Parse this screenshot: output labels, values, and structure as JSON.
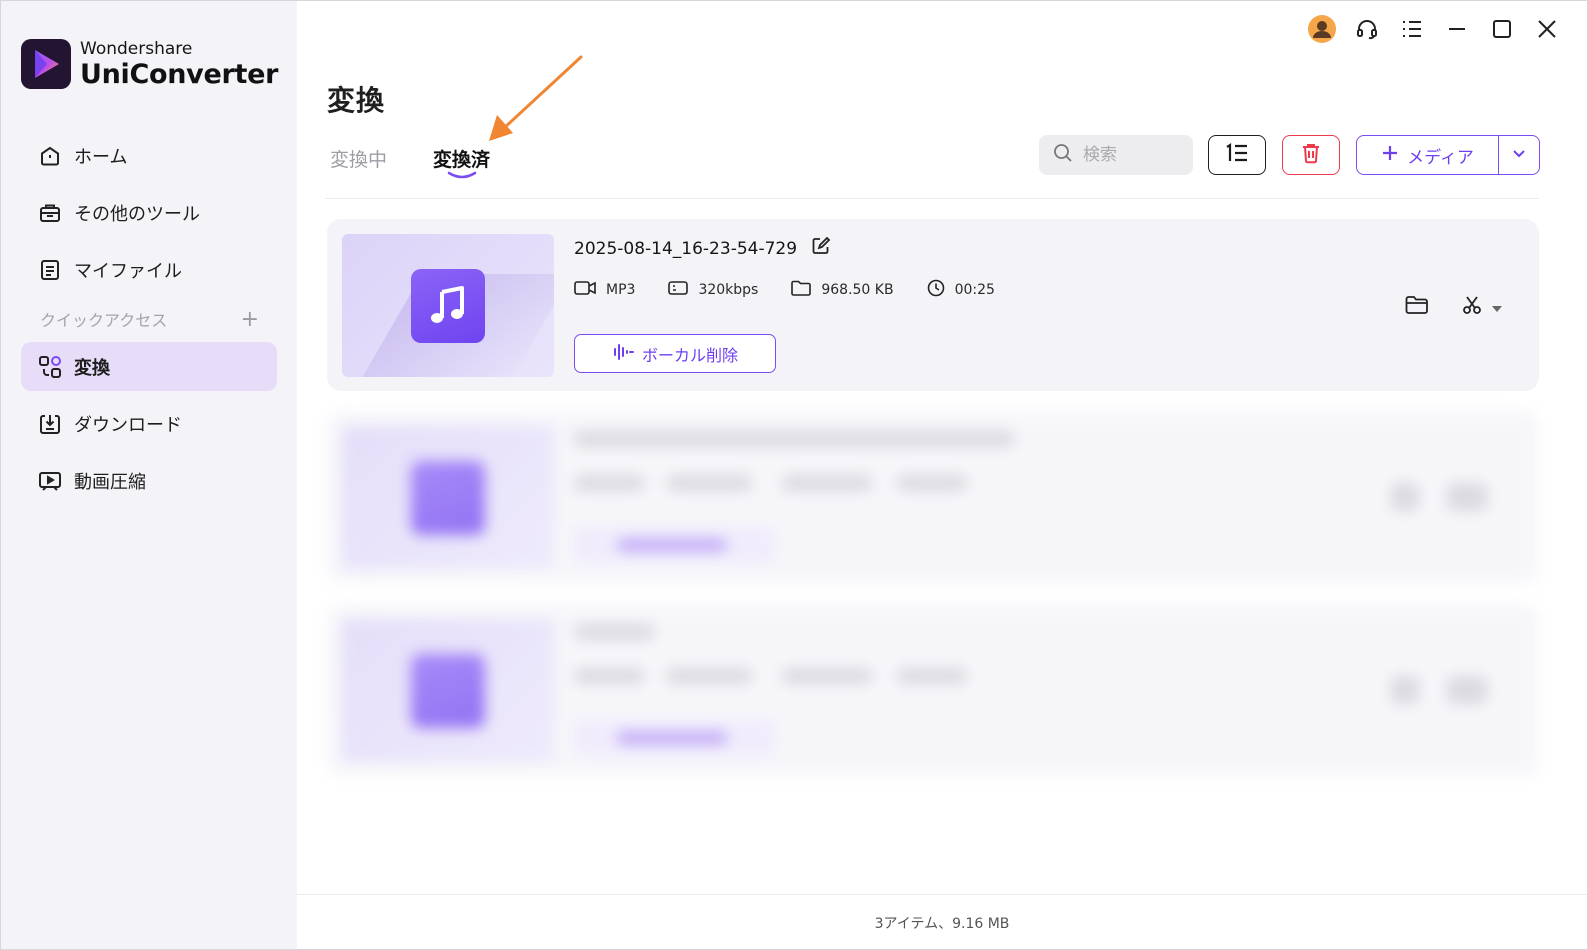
{
  "app": {
    "brand": "Wondershare",
    "product": "UniConverter"
  },
  "sidebar": {
    "items": [
      {
        "label": "ホーム",
        "icon": "home-icon"
      },
      {
        "label": "その他のツール",
        "icon": "toolbox-icon"
      },
      {
        "label": "マイファイル",
        "icon": "file-icon"
      }
    ],
    "quick_access_label": "クイックアクセス",
    "quick_items": [
      {
        "label": "変換",
        "icon": "convert-icon",
        "active": true
      },
      {
        "label": "ダウンロード",
        "icon": "download-icon"
      },
      {
        "label": "動画圧縮",
        "icon": "compress-icon"
      }
    ]
  },
  "main": {
    "title": "変換",
    "tabs": [
      {
        "label": "変換中",
        "active": false
      },
      {
        "label": "変換済",
        "active": true
      }
    ],
    "search_placeholder": "検索",
    "add_media_label": "メディア"
  },
  "files": [
    {
      "name": "2025-08-14_16-23-54-729",
      "format": "MP3",
      "bitrate": "320kbps",
      "size": "968.50 KB",
      "duration": "00:25",
      "action_label": "ボーカル削除"
    }
  ],
  "status": {
    "summary": "3アイテム、9.16 MB"
  },
  "colors": {
    "accent": "#7b4cf2",
    "active_nav_bg": "#e7ddf9",
    "delete": "#ee3b4c",
    "annotation_arrow": "#f08532"
  }
}
